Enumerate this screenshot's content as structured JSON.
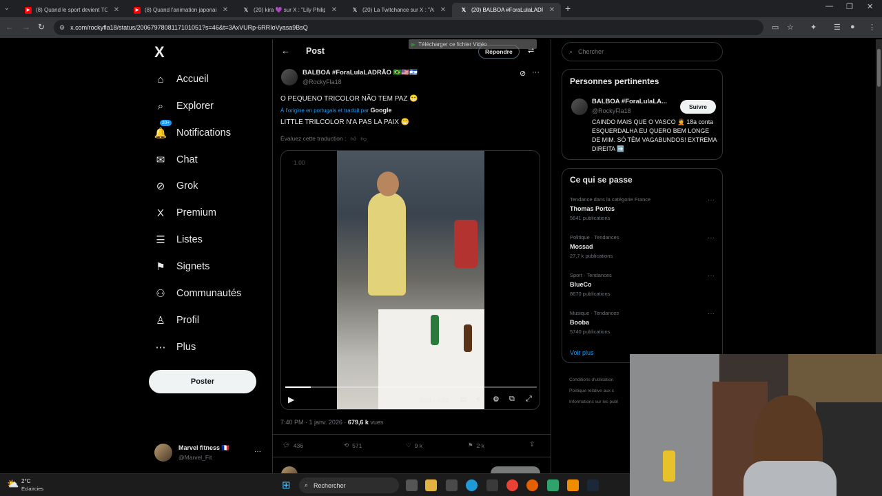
{
  "browser": {
    "tabs": [
      {
        "title": "(8) Quand le sport devient TO",
        "icon": "youtube-icon"
      },
      {
        "title": "(8) Quand l'animation japonaise",
        "icon": "youtube-icon"
      },
      {
        "title": "(20) kira 💜 sur X : \"Lily Philips",
        "icon": "x-icon"
      },
      {
        "title": "(20) La Twitchance sur X : \"ALER",
        "icon": "x-icon"
      },
      {
        "title": "(20) BALBOA #ForaLulaLADRÃO",
        "icon": "x-icon"
      }
    ],
    "new_tab": "+",
    "url": "x.com/rockyfla18/status/2006797808117101051?s=46&t=3AxVURp-6RRIoVyasa9BsQ"
  },
  "nav": {
    "logo": "X",
    "items": [
      {
        "label": "Accueil",
        "icon": "home-icon",
        "glyph": "⌂"
      },
      {
        "label": "Explorer",
        "icon": "search-icon",
        "glyph": "⌕"
      },
      {
        "label": "Notifications",
        "icon": "bell-icon",
        "glyph": "🔔",
        "badge": "20+"
      },
      {
        "label": "Chat",
        "icon": "mail-icon",
        "glyph": "✉"
      },
      {
        "label": "Grok",
        "icon": "grok-icon",
        "glyph": "⊘"
      },
      {
        "label": "Premium",
        "icon": "x-premium-icon",
        "glyph": "X"
      },
      {
        "label": "Listes",
        "icon": "list-icon",
        "glyph": "☰"
      },
      {
        "label": "Signets",
        "icon": "bookmark-icon",
        "glyph": "⚑"
      },
      {
        "label": "Communautés",
        "icon": "communities-icon",
        "glyph": "⚇"
      },
      {
        "label": "Profil",
        "icon": "profile-icon",
        "glyph": "♙"
      },
      {
        "label": "Plus",
        "icon": "more-icon",
        "glyph": "⋯"
      }
    ],
    "post_button": "Poster",
    "account": {
      "name": "Marvel fitness 🇫🇷",
      "handle": "@Marvel_Fit",
      "more": "···"
    }
  },
  "post": {
    "header_title": "Post",
    "reply_button": "Répondre",
    "download_overlay": "Télécharger ce fichier Vidéo",
    "author_name": "BALBOA #ForaLulaLADRÃO 🇧🇷🇺🇸🇮🇱",
    "author_handle": "@RockyFla18",
    "original_text": "O PEQUENO TRICOLOR NÃO TEM PAZ 😁",
    "translation_note": "À l'origine en portugais et traduit par",
    "translation_brand": "Google",
    "translated_text": "LITTLE TRILCOLOR N'A PAS LA PAIX 😁",
    "rate_translation": "Évaluez cette traduction :",
    "video": {
      "speed_label": "1.00",
      "time": "0:03 / 0:31",
      "progress": 0.1
    },
    "timestamp": "7:40 PM · 1 janv. 2026 · ",
    "views_count": "679,6 k",
    "views_label": " vues",
    "actions": {
      "replies": "436",
      "reposts": "571",
      "likes": "9 k",
      "bookmarks": "2 k"
    }
  },
  "right": {
    "search_placeholder": "Chercher",
    "relevant_title": "Personnes pertinentes",
    "relevant_person": {
      "name": "BALBOA #ForaLulaLA...",
      "handle": "@RockyFla18",
      "follow": "Suivre",
      "bio": "CAINDO MAIS QUE O VASCO 🤦 18a conta ESQUERDALHA EU QUERO BEM LONGE DE MIM. SÓ TÊM VAGABUNDOS! EXTREMA DIREITA ➡️"
    },
    "trends_title": "Ce qui se passe",
    "trends": [
      {
        "meta": "Tendance dans la catégorie France",
        "name": "Thomas Portes",
        "count": "5641 publications"
      },
      {
        "meta": "Politique · Tendances",
        "name": "Mossad",
        "count": "27,7 k publications"
      },
      {
        "meta": "Sport · Tendances",
        "name": "BlueCo",
        "count": "8670 publications"
      },
      {
        "meta": "Musique · Tendances",
        "name": "Booba",
        "count": "5740 publications"
      }
    ],
    "see_more": "Voir plus",
    "footer": [
      "Conditions d'utilisation",
      "Politique relative aux c",
      "Informations sur les publ"
    ]
  },
  "taskbar": {
    "weather_temp": "2°C",
    "weather_desc": "Éclaircies",
    "search_placeholder": "Rechercher"
  }
}
